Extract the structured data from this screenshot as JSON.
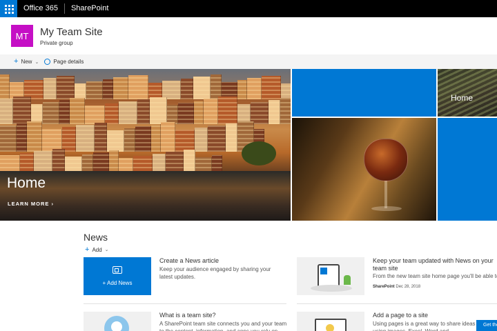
{
  "suite": {
    "app_name": "Office 365",
    "product": "SharePoint"
  },
  "site": {
    "logo_initials": "MT",
    "logo_color": "#c50fc5",
    "title": "My Team Site",
    "subtitle": "Private group"
  },
  "command_bar": {
    "new_label": "New",
    "page_details_label": "Page details"
  },
  "hero": {
    "main_title": "Home",
    "main_link": "LEARN MORE",
    "tile_label": "Home"
  },
  "news": {
    "heading": "News",
    "add_label": "Add",
    "add_card_label": "Add News",
    "articles": [
      {
        "title": "Create a News article",
        "description": "Keep your audience engaged by sharing your latest updates."
      },
      {
        "title": "Keep your team updated with News on your team site",
        "description": "From the new team site home page you'll be able to...",
        "author": "SharePoint",
        "date": "Dec 28, 2018"
      },
      {
        "title": "What is a team site?",
        "description": "A SharePoint team site connects you and your team to the content, information, and apps you rely on every"
      },
      {
        "title": "Add a page to a site",
        "description": "Using pages is a great way to share ideas using images, Excel, Word and PowerPoint docs"
      }
    ]
  },
  "footer": {
    "get_app_label": "Get the"
  },
  "colors": {
    "accent": "#0078d4",
    "suite_bar": "#000000"
  }
}
